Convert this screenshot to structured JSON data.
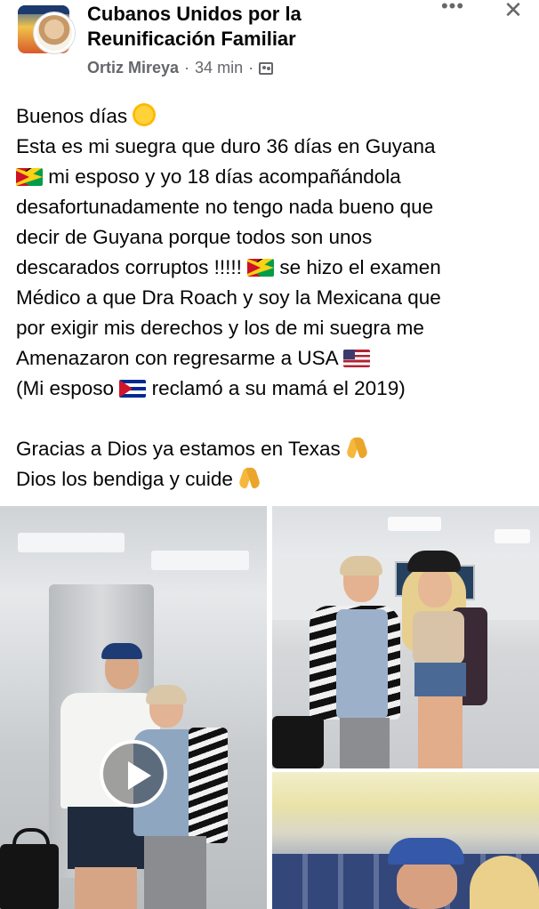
{
  "header": {
    "group_name_line1": "Cubanos Unidos por la",
    "group_name_line2": "Reunificación Familiar",
    "author": "Ortiz Mireya",
    "separator": "·",
    "time": "34 min",
    "more_label": "•••",
    "close_label": "✕"
  },
  "post": {
    "lines": [
      "Buenos días",
      "Esta es mi suegra que duro 36 días en Guyana",
      "mi esposo y yo 18 días acompañándola",
      "desafortunadamente no tengo nada bueno que",
      "decir de Guyana porque todos son unos",
      "descarados corruptos !!!!!",
      "se hizo el examen",
      "Médico a que Dra Roach y soy la Mexicana que",
      "por exigir mis derechos y los de mi suegra me",
      "Amenazaron con regresarme a USA",
      "(Mi esposo",
      "reclamó a su mamá el 2019)",
      "Gracias a Dios ya estamos en Texas",
      "Dios los bendiga y cuide"
    ],
    "emojis": [
      "sun",
      "flag-guyana",
      "flag-usa",
      "flag-cuba",
      "folded-hands"
    ]
  },
  "media": {
    "photo_count": 3,
    "video_overlay": "play-icon"
  },
  "colors": {
    "text": "#050505",
    "meta": "#65676b",
    "background": "#ffffff"
  }
}
